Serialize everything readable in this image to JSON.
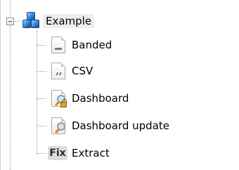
{
  "tree": {
    "root": {
      "label": "Example",
      "icon": "cubes-icon",
      "expanded": true
    },
    "children": [
      {
        "label": "Banded",
        "icon": "banded-report-icon"
      },
      {
        "label": "CSV",
        "icon": "csv-file-icon"
      },
      {
        "label": "Dashboard",
        "icon": "dashboard-lock-icon"
      },
      {
        "label": "Dashboard update",
        "icon": "dashboard-icon"
      },
      {
        "label": "Extract",
        "icon": "fix-icon",
        "icon_text": "Fix"
      }
    ]
  },
  "colors": {
    "line": "#9a9a9a",
    "selected_bg": "#eeeeee",
    "accent": "#2f7ed8"
  }
}
